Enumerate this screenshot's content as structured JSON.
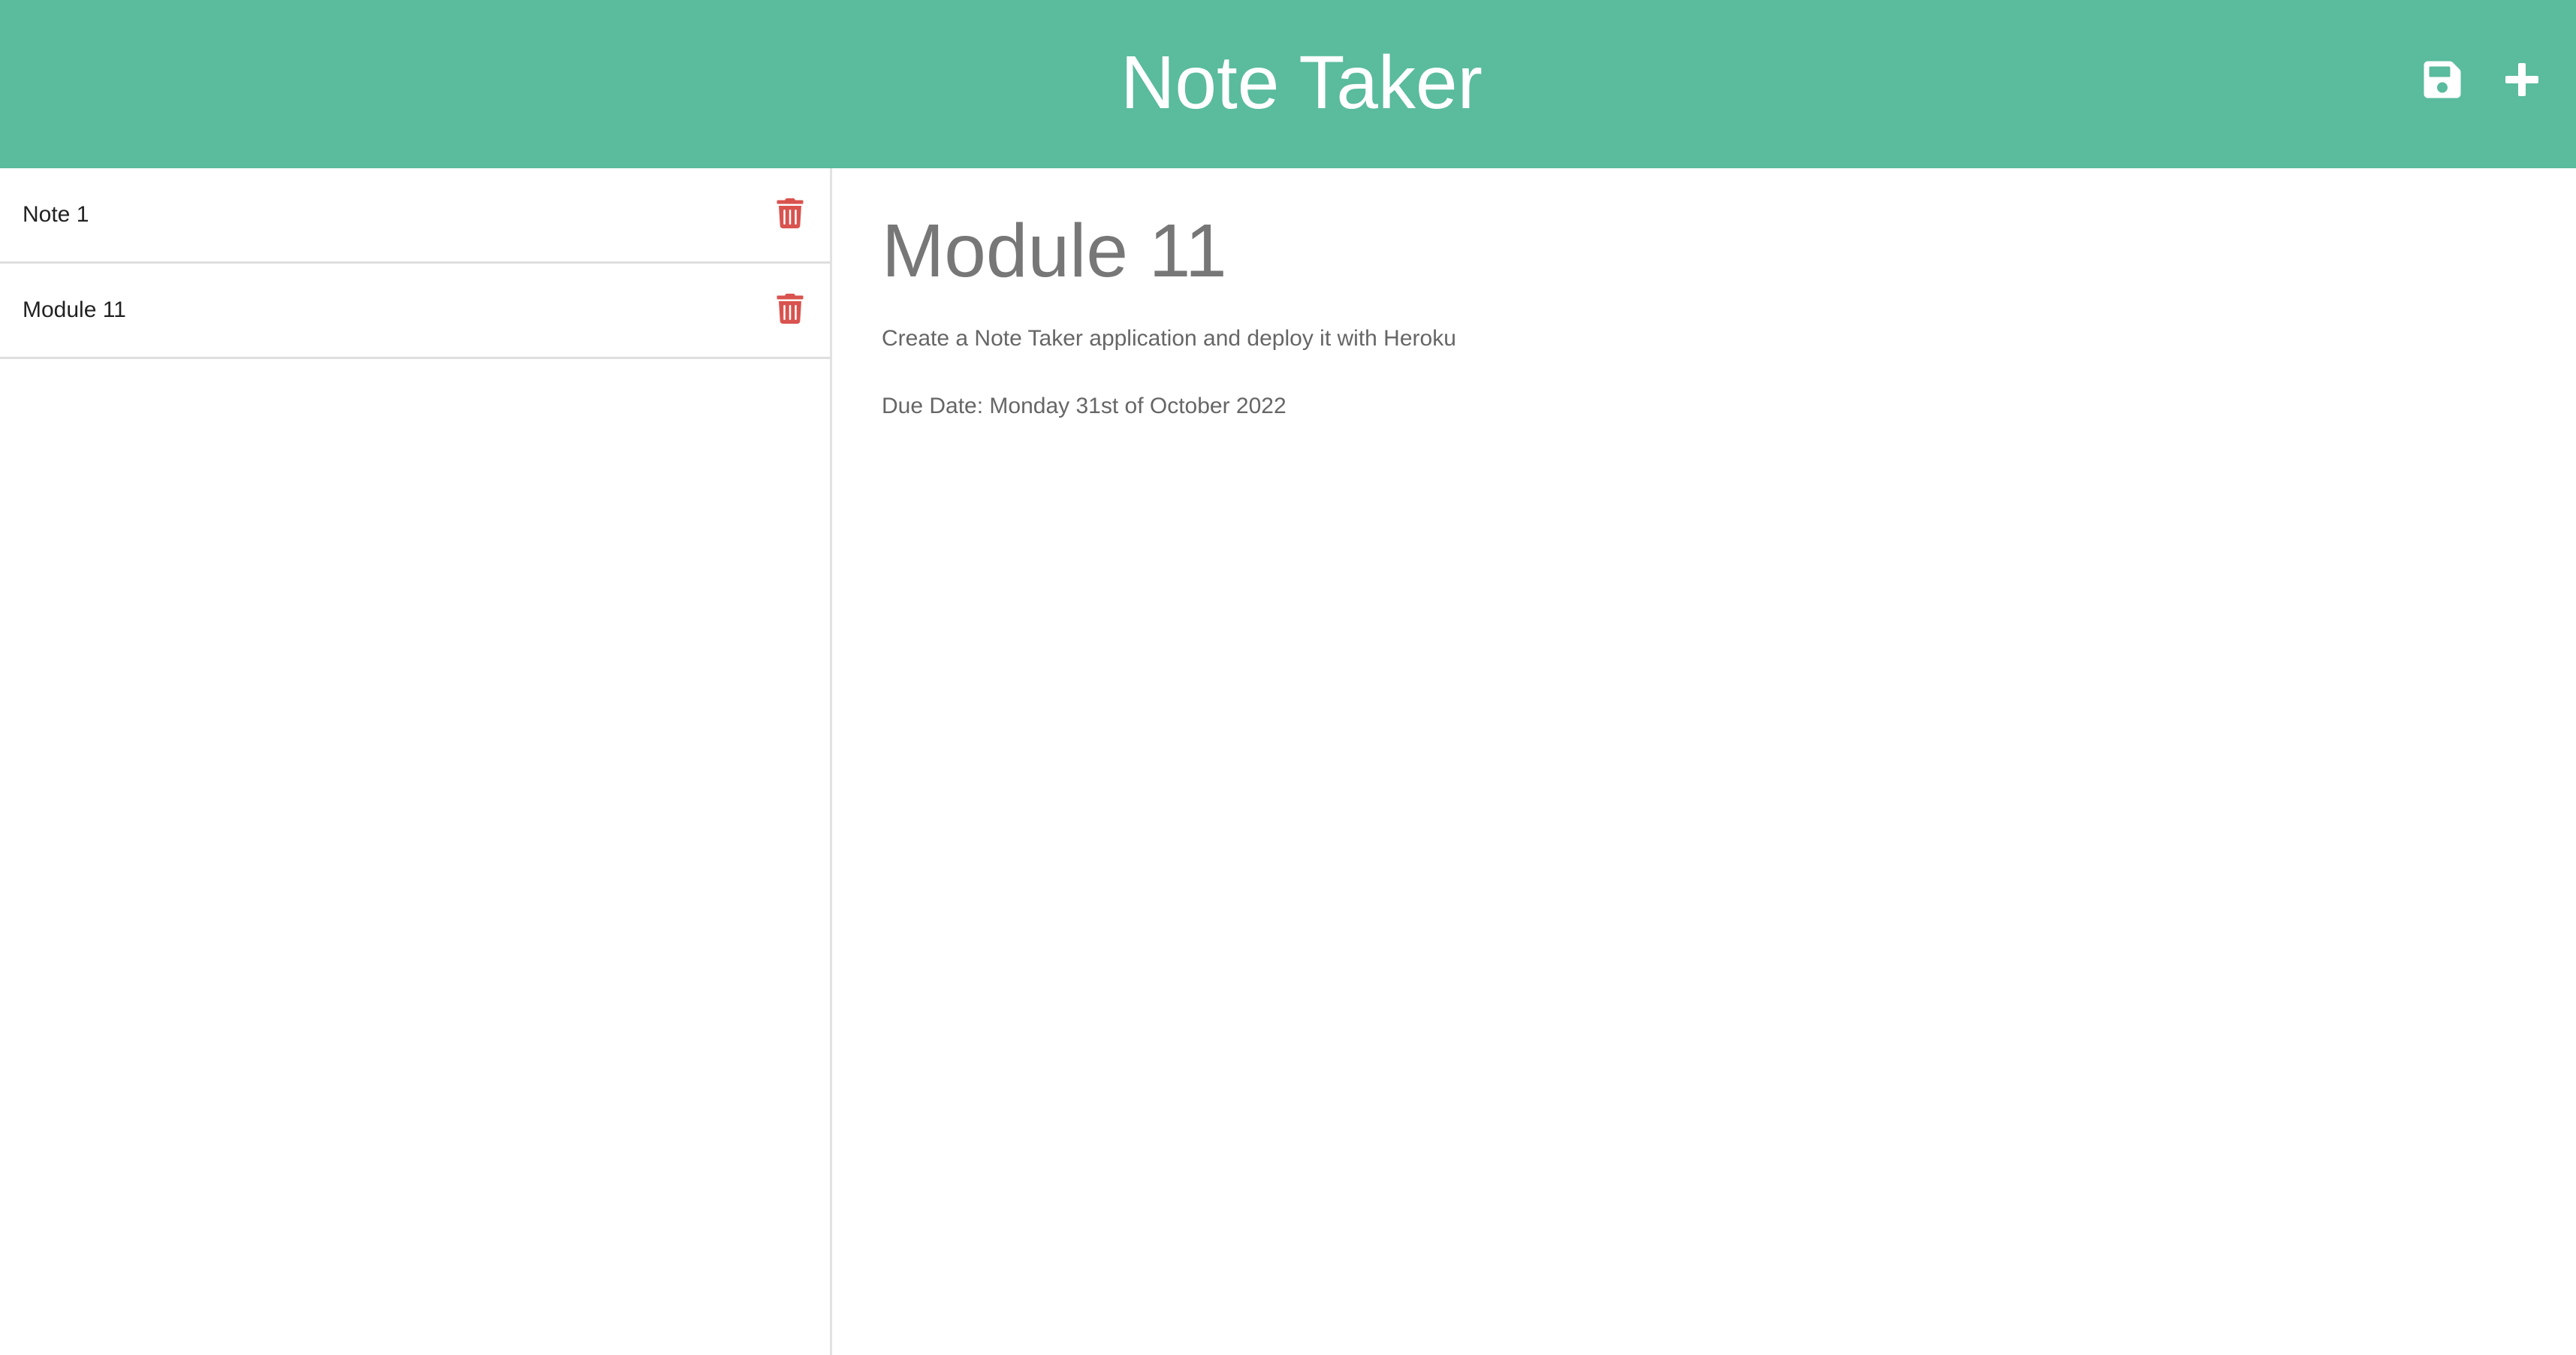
{
  "header": {
    "title": "Note Taker",
    "icons": {
      "save": "save-icon",
      "new_note": "plus-icon"
    },
    "background_color": "#5abb9d",
    "text_color": "#ffffff"
  },
  "sidebar": {
    "notes": [
      {
        "label": "Note 1",
        "delete_icon": "trash-icon"
      },
      {
        "label": "Module 11",
        "delete_icon": "trash-icon"
      }
    ],
    "delete_color": "#d9534f"
  },
  "editor": {
    "title": "Module 11",
    "text_lines": [
      "Create a Note Taker application and deploy it with Heroku",
      "Due Date: Monday 31st of October 2022"
    ]
  }
}
